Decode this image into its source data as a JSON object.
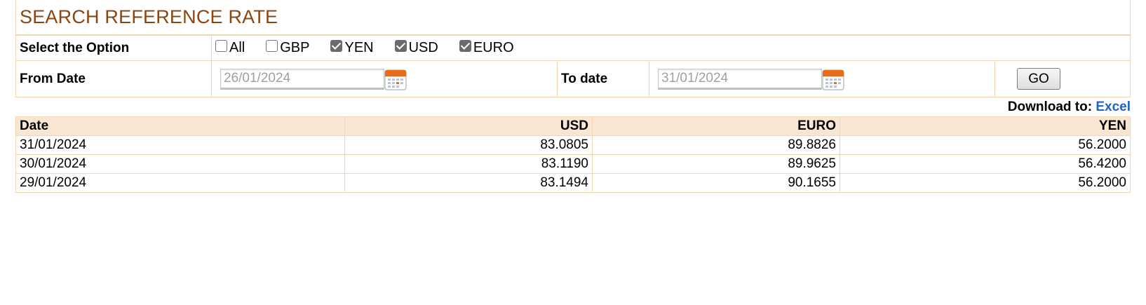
{
  "page": {
    "title": "SEARCH REFERENCE RATE"
  },
  "options": {
    "label": "Select the Option",
    "items": [
      {
        "label": "All",
        "checked": false
      },
      {
        "label": "GBP",
        "checked": false
      },
      {
        "label": "YEN",
        "checked": true
      },
      {
        "label": "USD",
        "checked": true
      },
      {
        "label": "EURO",
        "checked": true
      }
    ]
  },
  "dates": {
    "from_label": "From Date",
    "from_value": "26/01/2024",
    "to_label": "To date",
    "to_value": "31/01/2024",
    "go_label": "GO"
  },
  "download": {
    "label": "Download to:",
    "link": "Excel"
  },
  "rates": {
    "headers": [
      "Date",
      "USD",
      "EURO",
      "YEN"
    ],
    "rows": [
      [
        "31/01/2024",
        "83.0805",
        "89.8826",
        "56.2000"
      ],
      [
        "30/01/2024",
        "83.1190",
        "89.9625",
        "56.4200"
      ],
      [
        "29/01/2024",
        "83.1494",
        "90.1655",
        "56.2000"
      ]
    ]
  },
  "colors": {
    "title": "#8b4513",
    "border": "#f3d5b0",
    "header_bg": "#f8e6d3",
    "link": "#1f62c9"
  },
  "icons": {
    "calendar": "calendar-icon",
    "checkbox": "checkbox-icon"
  }
}
